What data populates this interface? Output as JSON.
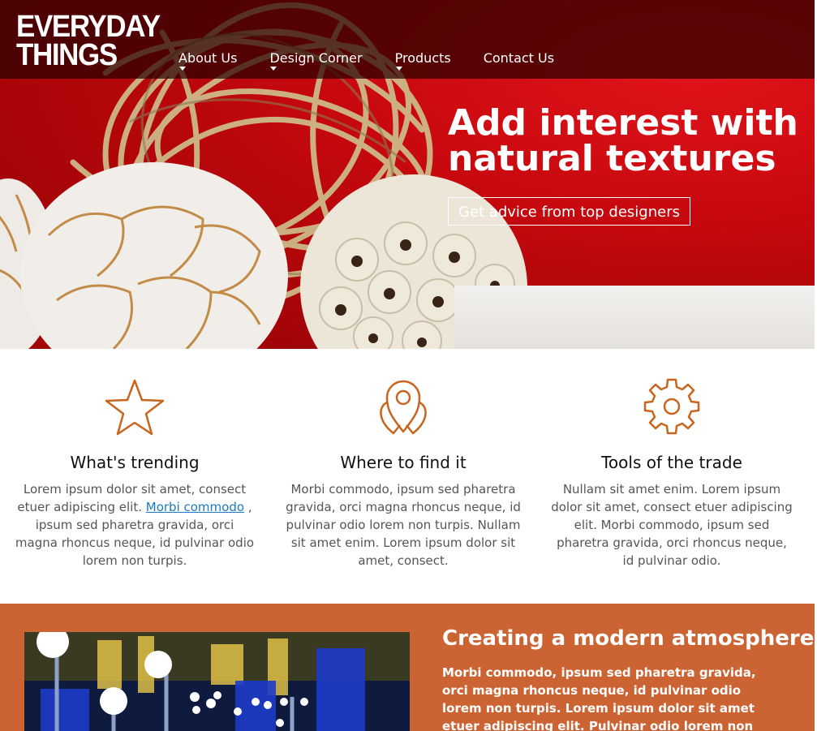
{
  "header": {
    "logo_line1": "EVERYDAY",
    "logo_line2": "THINGS",
    "nav": [
      {
        "label": "About Us",
        "has_dropdown": true
      },
      {
        "label": "Design Corner",
        "has_dropdown": true
      },
      {
        "label": "Products",
        "has_dropdown": true
      },
      {
        "label": "Contact Us",
        "has_dropdown": false
      }
    ]
  },
  "hero": {
    "title": "Add interest with natural textures",
    "cta_label": "Get advice from top designers"
  },
  "features": [
    {
      "icon": "star-icon",
      "title": "What's trending",
      "text_before_link": "Lorem ipsum dolor sit amet, consect etuer adipiscing elit.",
      "link": "Morbi commodo",
      "text_after_link": ", ipsum sed pharetra gravida, orci magna rhoncus neque, id pulvinar odio lorem non turpis."
    },
    {
      "icon": "location-pin-icon",
      "title": "Where to find it",
      "text": "Morbi commodo, ipsum sed pharetra gravida, orci magna rhoncus neque, id pulvinar odio lorem non turpis. Nullam sit amet enim. Lorem ipsum dolor sit amet, consect."
    },
    {
      "icon": "gear-icon",
      "title": "Tools of the trade",
      "text": "Nullam sit amet enim. Lorem ipsum dolor sit amet, consect etuer adipiscing elit. Morbi commodo, ipsum sed pharetra gravida, orci rhoncus neque, id pulvinar odio."
    }
  ],
  "promo": {
    "title": "Creating a modern atmosphere",
    "text": "Morbi commodo, ipsum sed pharetra gravida, orci magna rhoncus neque, id pulvinar odio lorem non turpis. Lorem ipsum dolor sit amet etuer adipiscing elit. Pulvinar odio lorem non turpis. Nullam sit amet"
  },
  "colors": {
    "accent_orange": "#cc6333",
    "icon_orange": "#c8651e",
    "hero_red": "#c8090f",
    "link_blue": "#1a7ac8"
  }
}
